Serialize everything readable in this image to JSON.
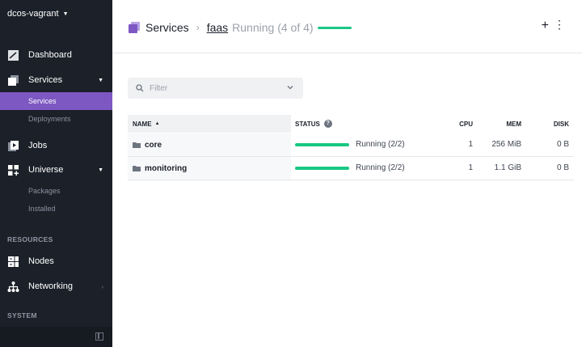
{
  "sidebar": {
    "cluster_name": "dcos-vagrant",
    "dashboard": "Dashboard",
    "services": "Services",
    "services_sub": [
      "Services",
      "Deployments"
    ],
    "jobs": "Jobs",
    "universe": "Universe",
    "universe_sub": [
      "Packages",
      "Installed"
    ],
    "resources_heading": "RESOURCES",
    "nodes": "Nodes",
    "networking": "Networking",
    "system_heading": "SYSTEM"
  },
  "header": {
    "title": "Services",
    "separator": "›",
    "service": "faas",
    "status": "Running (4 of 4)",
    "add_label": "+",
    "more_label": "⋮"
  },
  "filter": {
    "placeholder": "Filter",
    "value": ""
  },
  "table": {
    "columns": {
      "name": "NAME",
      "status": "STATUS",
      "cpu": "CPU",
      "mem": "MEM",
      "disk": "DISK"
    },
    "rows": [
      {
        "name": "core",
        "status": "Running (2/2)",
        "cpu": "1",
        "mem": "256 MiB",
        "disk": "0 B"
      },
      {
        "name": "monitoring",
        "status": "Running (2/2)",
        "cpu": "1",
        "mem": "1.1 GiB",
        "disk": "0 B"
      }
    ]
  },
  "colors": {
    "sidebar_bg": "#1b2029",
    "active_item": "#7d58c2",
    "status_green": "#19c884"
  }
}
